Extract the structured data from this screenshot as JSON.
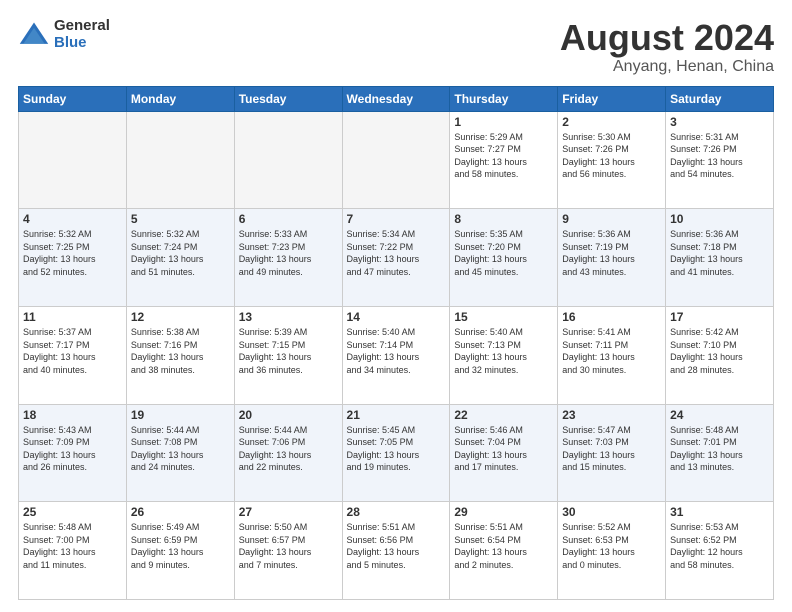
{
  "logo": {
    "general": "General",
    "blue": "Blue"
  },
  "title": "August 2024",
  "location": "Anyang, Henan, China",
  "days_of_week": [
    "Sunday",
    "Monday",
    "Tuesday",
    "Wednesday",
    "Thursday",
    "Friday",
    "Saturday"
  ],
  "weeks": [
    [
      {
        "day": "",
        "info": ""
      },
      {
        "day": "",
        "info": ""
      },
      {
        "day": "",
        "info": ""
      },
      {
        "day": "",
        "info": ""
      },
      {
        "day": "1",
        "info": "Sunrise: 5:29 AM\nSunset: 7:27 PM\nDaylight: 13 hours\nand 58 minutes."
      },
      {
        "day": "2",
        "info": "Sunrise: 5:30 AM\nSunset: 7:26 PM\nDaylight: 13 hours\nand 56 minutes."
      },
      {
        "day": "3",
        "info": "Sunrise: 5:31 AM\nSunset: 7:26 PM\nDaylight: 13 hours\nand 54 minutes."
      }
    ],
    [
      {
        "day": "4",
        "info": "Sunrise: 5:32 AM\nSunset: 7:25 PM\nDaylight: 13 hours\nand 52 minutes."
      },
      {
        "day": "5",
        "info": "Sunrise: 5:32 AM\nSunset: 7:24 PM\nDaylight: 13 hours\nand 51 minutes."
      },
      {
        "day": "6",
        "info": "Sunrise: 5:33 AM\nSunset: 7:23 PM\nDaylight: 13 hours\nand 49 minutes."
      },
      {
        "day": "7",
        "info": "Sunrise: 5:34 AM\nSunset: 7:22 PM\nDaylight: 13 hours\nand 47 minutes."
      },
      {
        "day": "8",
        "info": "Sunrise: 5:35 AM\nSunset: 7:20 PM\nDaylight: 13 hours\nand 45 minutes."
      },
      {
        "day": "9",
        "info": "Sunrise: 5:36 AM\nSunset: 7:19 PM\nDaylight: 13 hours\nand 43 minutes."
      },
      {
        "day": "10",
        "info": "Sunrise: 5:36 AM\nSunset: 7:18 PM\nDaylight: 13 hours\nand 41 minutes."
      }
    ],
    [
      {
        "day": "11",
        "info": "Sunrise: 5:37 AM\nSunset: 7:17 PM\nDaylight: 13 hours\nand 40 minutes."
      },
      {
        "day": "12",
        "info": "Sunrise: 5:38 AM\nSunset: 7:16 PM\nDaylight: 13 hours\nand 38 minutes."
      },
      {
        "day": "13",
        "info": "Sunrise: 5:39 AM\nSunset: 7:15 PM\nDaylight: 13 hours\nand 36 minutes."
      },
      {
        "day": "14",
        "info": "Sunrise: 5:40 AM\nSunset: 7:14 PM\nDaylight: 13 hours\nand 34 minutes."
      },
      {
        "day": "15",
        "info": "Sunrise: 5:40 AM\nSunset: 7:13 PM\nDaylight: 13 hours\nand 32 minutes."
      },
      {
        "day": "16",
        "info": "Sunrise: 5:41 AM\nSunset: 7:11 PM\nDaylight: 13 hours\nand 30 minutes."
      },
      {
        "day": "17",
        "info": "Sunrise: 5:42 AM\nSunset: 7:10 PM\nDaylight: 13 hours\nand 28 minutes."
      }
    ],
    [
      {
        "day": "18",
        "info": "Sunrise: 5:43 AM\nSunset: 7:09 PM\nDaylight: 13 hours\nand 26 minutes."
      },
      {
        "day": "19",
        "info": "Sunrise: 5:44 AM\nSunset: 7:08 PM\nDaylight: 13 hours\nand 24 minutes."
      },
      {
        "day": "20",
        "info": "Sunrise: 5:44 AM\nSunset: 7:06 PM\nDaylight: 13 hours\nand 22 minutes."
      },
      {
        "day": "21",
        "info": "Sunrise: 5:45 AM\nSunset: 7:05 PM\nDaylight: 13 hours\nand 19 minutes."
      },
      {
        "day": "22",
        "info": "Sunrise: 5:46 AM\nSunset: 7:04 PM\nDaylight: 13 hours\nand 17 minutes."
      },
      {
        "day": "23",
        "info": "Sunrise: 5:47 AM\nSunset: 7:03 PM\nDaylight: 13 hours\nand 15 minutes."
      },
      {
        "day": "24",
        "info": "Sunrise: 5:48 AM\nSunset: 7:01 PM\nDaylight: 13 hours\nand 13 minutes."
      }
    ],
    [
      {
        "day": "25",
        "info": "Sunrise: 5:48 AM\nSunset: 7:00 PM\nDaylight: 13 hours\nand 11 minutes."
      },
      {
        "day": "26",
        "info": "Sunrise: 5:49 AM\nSunset: 6:59 PM\nDaylight: 13 hours\nand 9 minutes."
      },
      {
        "day": "27",
        "info": "Sunrise: 5:50 AM\nSunset: 6:57 PM\nDaylight: 13 hours\nand 7 minutes."
      },
      {
        "day": "28",
        "info": "Sunrise: 5:51 AM\nSunset: 6:56 PM\nDaylight: 13 hours\nand 5 minutes."
      },
      {
        "day": "29",
        "info": "Sunrise: 5:51 AM\nSunset: 6:54 PM\nDaylight: 13 hours\nand 2 minutes."
      },
      {
        "day": "30",
        "info": "Sunrise: 5:52 AM\nSunset: 6:53 PM\nDaylight: 13 hours\nand 0 minutes."
      },
      {
        "day": "31",
        "info": "Sunrise: 5:53 AM\nSunset: 6:52 PM\nDaylight: 12 hours\nand 58 minutes."
      }
    ]
  ]
}
